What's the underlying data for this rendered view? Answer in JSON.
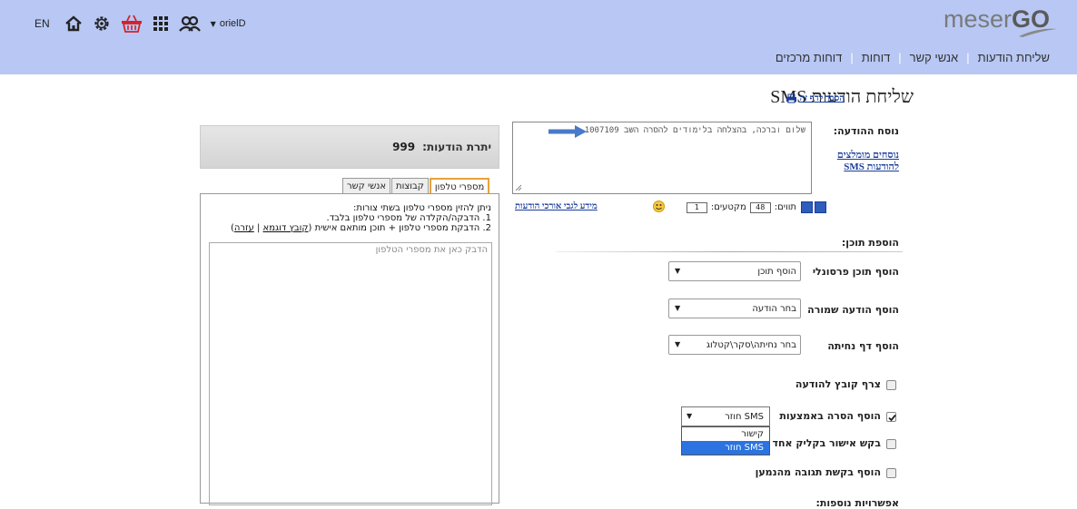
{
  "header": {
    "brand_part1": "meser",
    "brand_part2": "GO",
    "nav": [
      "שליחת הודעות",
      "אנשי קשר",
      "דוחות",
      "דוחות מרכזים"
    ],
    "lang": "EN",
    "username": "orielD"
  },
  "page": {
    "title": "שליחת הודעות SMS",
    "help_link": "הסבר לדף זה"
  },
  "message": {
    "label": "נוסח ההודעה:",
    "text": "שלום וברכה, בהצלחה בלימודים להסרה השב 1007109",
    "recommended_link": "נוסחים מומלצים להודעות SMS",
    "chars_label": "תווים:",
    "chars_value": "48",
    "segments_label": "מקטעים:",
    "segments_value": "1",
    "long_info_link": "מידע לגבי אורכי הודעות"
  },
  "add_content": {
    "section_title": "הוספת תוכן:",
    "personal_label": "הוסף תוכן פרסונלי",
    "personal_value": "הוסף תוכן",
    "saved_label": "הוסף הודעה שמורה",
    "saved_value": "בחר הודעה",
    "landing_label": "הוסף דף נחיתה",
    "landing_value": "בחר נחיתה\\סקר\\קטלוג"
  },
  "options": {
    "attach_label": "צרף קובץ להודעה",
    "removal_label": "הוסף הסרה באמצעות",
    "removal_value": "SMS חוזר",
    "removal_options": [
      "קישור",
      "SMS חוזר"
    ],
    "confirm_label": "בקש אישור בקליק אחד",
    "reply_label": "הוסף בקשת תגובה מהנמען",
    "more_label": "אפשרויות נוספות:"
  },
  "credit": {
    "label": "יתרת הודעות:",
    "value": "999"
  },
  "recipients": {
    "tabs": [
      "מספרי טלפון",
      "קבוצות",
      "אנשי קשר"
    ],
    "instr_line1": "ניתן להזין מספרי טלפון בשתי צורות:",
    "instr_line2": "1. הדבקה/הקלדה של מספרי טלפון בלבד.",
    "instr_line3": "2. הדבקת מספרי טלפון + תוכן מותאם אישית (",
    "sample_link": "קובץ דוגמא",
    "instr_sep": " | ",
    "help_link": "עזרה",
    "instr_close": ")",
    "placeholder": "הדבק כאן את מספרי הטלפון"
  }
}
